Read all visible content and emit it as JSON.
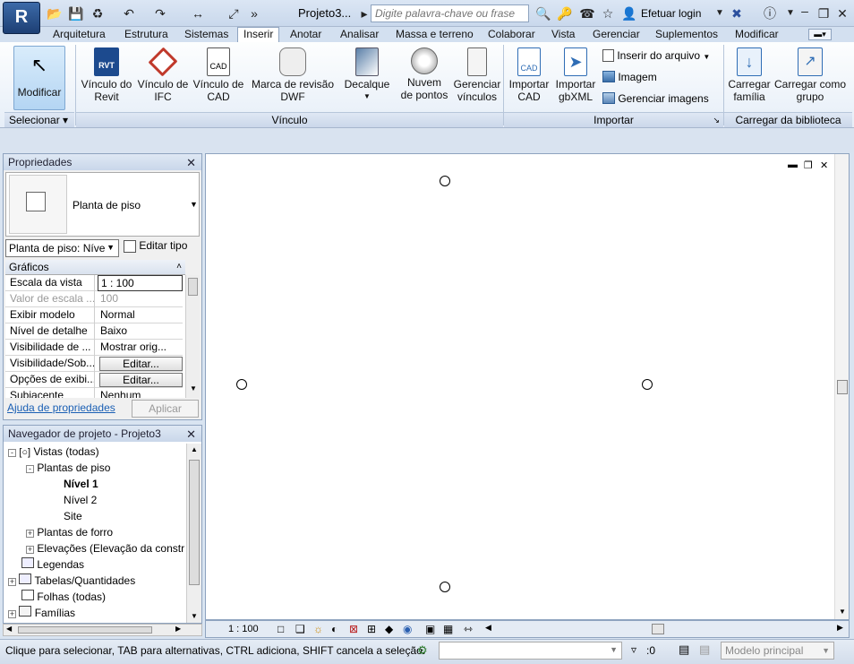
{
  "app": {
    "logo": "R",
    "doc_title": "Projeto3...",
    "search_placeholder": "Digite palavra-chave ou frase",
    "login": "Efetuar login"
  },
  "tabs": [
    "Arquitetura",
    "Estrutura",
    "Sistemas",
    "Inserir",
    "Anotar",
    "Analisar",
    "Massa e terreno",
    "Colaborar",
    "Vista",
    "Gerenciar",
    "Suplementos",
    "Modificar"
  ],
  "ribbon": {
    "modificar": "Modificar",
    "selecionar": "Selecionar",
    "vinculo": {
      "title": "Vínculo",
      "buttons": [
        [
          "Vínculo do",
          "Revit"
        ],
        [
          "Vínculo de",
          "IFC"
        ],
        [
          "Vínculo de",
          "CAD"
        ],
        [
          "Marca de revisão",
          "DWF"
        ],
        [
          "Decalque",
          ""
        ],
        [
          "Nuvem",
          "de pontos"
        ],
        [
          "Gerenciar",
          "vínculos"
        ]
      ]
    },
    "importar": {
      "title": "Importar",
      "buttons": [
        [
          "Importar",
          "CAD"
        ],
        [
          "Importar",
          "gbXML"
        ]
      ],
      "small": [
        "Inserir do  arquivo",
        "Imagem",
        "Gerenciar  imagens"
      ]
    },
    "biblioteca": {
      "title": "Carregar da biblioteca",
      "buttons": [
        [
          "Carregar",
          "família"
        ],
        [
          "Carregar como",
          "grupo"
        ]
      ]
    }
  },
  "properties": {
    "title": "Propriedades",
    "type_name": "Planta de piso",
    "type_select": "Planta de piso: Níve",
    "edit_type": "Editar tipo",
    "section": "Gráficos",
    "rows": [
      {
        "name": "Escala da vista",
        "value": "1 : 100"
      },
      {
        "name": "Valor de escala ...",
        "value": "100"
      },
      {
        "name": "Exibir modelo",
        "value": "Normal"
      },
      {
        "name": "Nível de detalhe",
        "value": "Baixo"
      },
      {
        "name": "Visibilidade de ...",
        "value": "Mostrar orig..."
      },
      {
        "name": "Visibilidade/Sob...",
        "value": "Editar..."
      },
      {
        "name": "Opções de exibi...",
        "value": "Editar..."
      },
      {
        "name": "Subjacente",
        "value": "Nenhum"
      }
    ],
    "help": "Ajuda de propriedades",
    "apply": "Aplicar"
  },
  "navigator": {
    "title": "Navegador de projeto - Projeto3",
    "items": [
      "Vistas (todas)",
      "Plantas de piso",
      "Nível 1",
      "Nível 2",
      "Site",
      "Plantas de forro",
      "Elevações (Elevação da constr",
      "Legendas",
      "Tabelas/Quantidades",
      "Folhas (todas)",
      "Famílias"
    ]
  },
  "viewbar": {
    "scale": "1 : 100"
  },
  "status": {
    "message": "Clique para selecionar, TAB para alternativas, CTRL adiciona, SHIFT cancela a seleção.",
    "filter": ":0",
    "model": "Modelo principal"
  }
}
